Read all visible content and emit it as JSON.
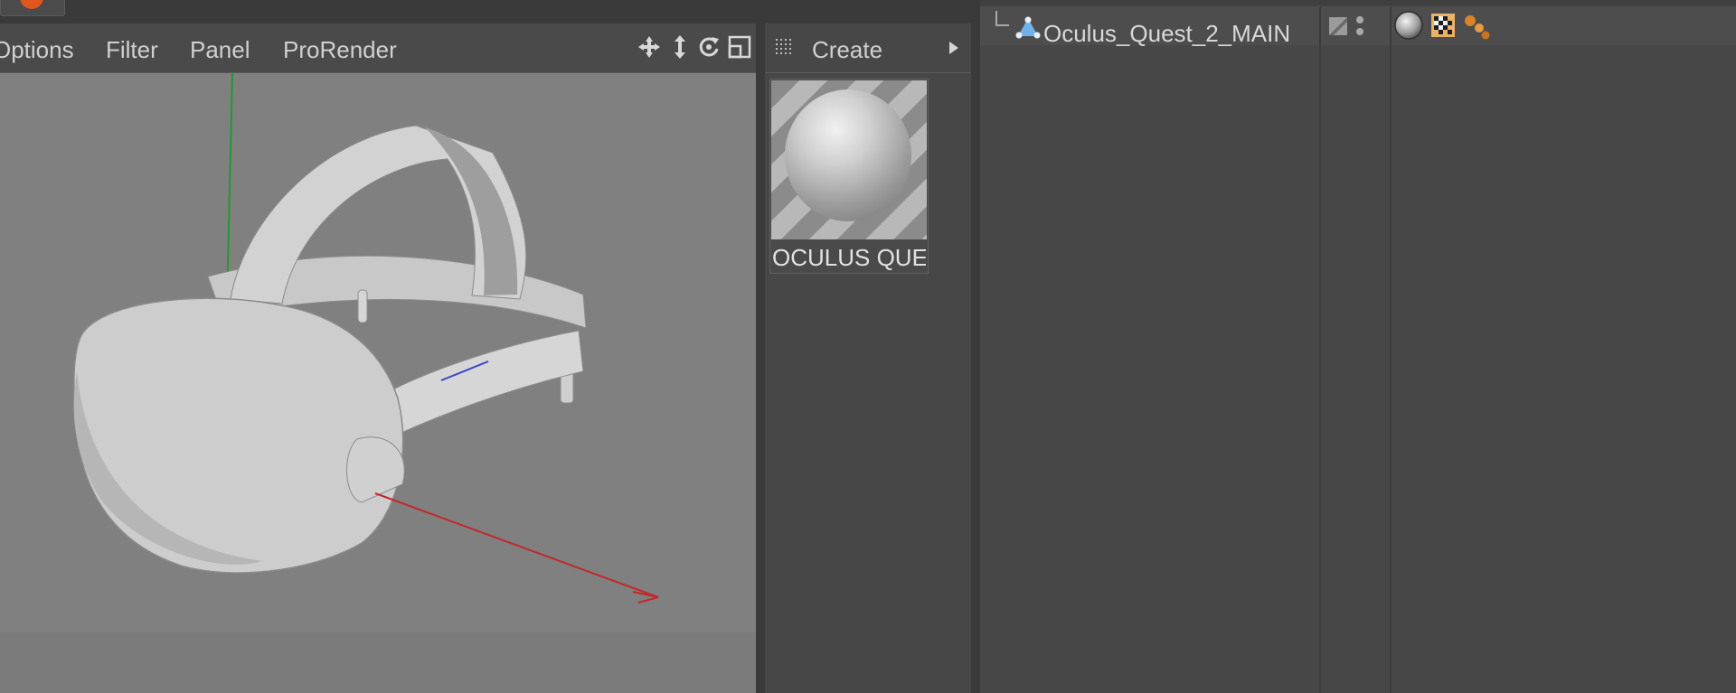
{
  "viewport": {
    "menu": [
      "Options",
      "Filter",
      "Panel",
      "ProRender"
    ],
    "nav_icons": [
      "move-view-icon",
      "zoom-view-icon",
      "rotate-view-icon",
      "toggle-view-icon"
    ]
  },
  "material_manager": {
    "create_label": "Create",
    "material_name": "OCULUS QUE"
  },
  "object_manager": {
    "object_name": "Oculus_Quest_2_MAIN",
    "tag_icons": [
      "material-tag-icon",
      "texture-tag-icon",
      "mograph-tag-icon"
    ]
  },
  "colors": {
    "accent_orange": "#e0561e",
    "axis_x": "#c0282c",
    "axis_y": "#1f9a2f",
    "axis_z": "#3846c8"
  }
}
